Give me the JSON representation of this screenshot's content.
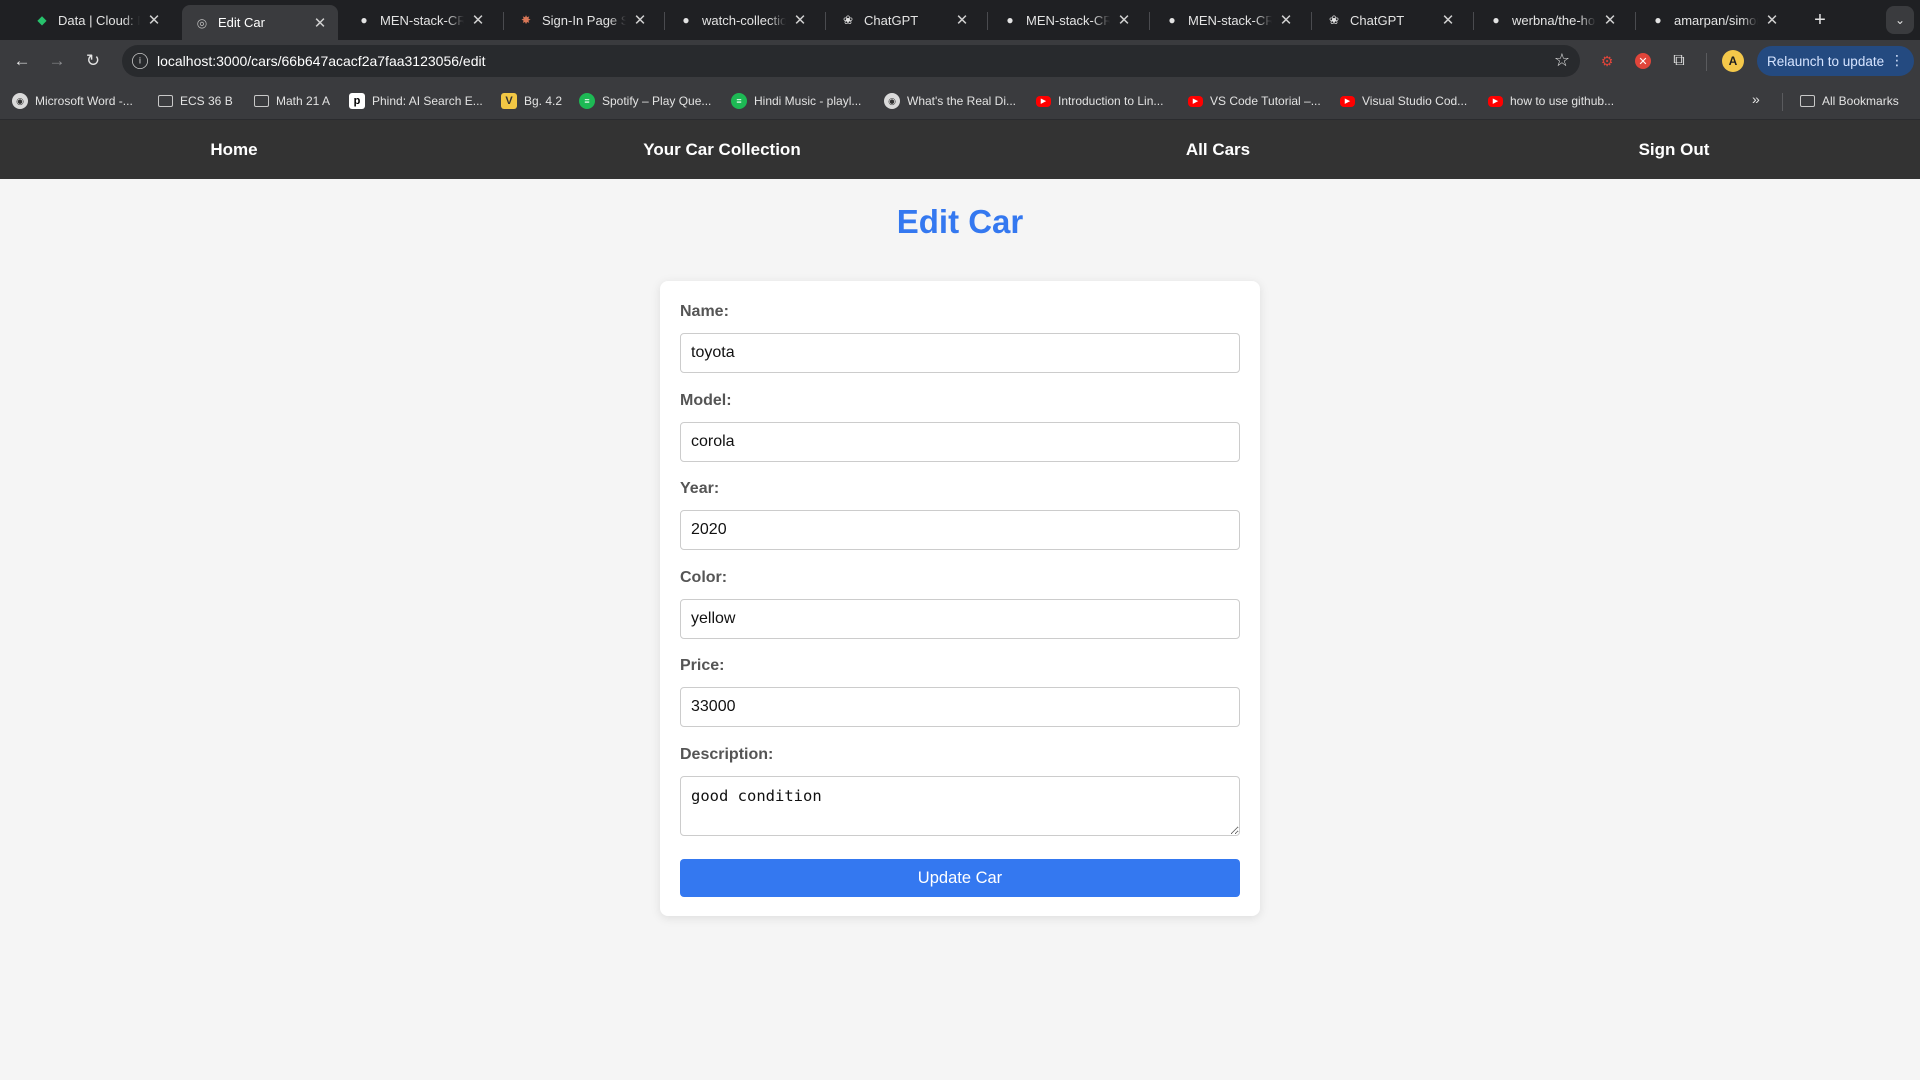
{
  "browser": {
    "tabs": [
      {
        "title": "Data | Cloud: Mo",
        "icon": "mongodb-icon",
        "active": false
      },
      {
        "title": "Edit Car",
        "icon": "globe-icon",
        "active": true
      },
      {
        "title": "MEN-stack-CRU",
        "icon": "github-icon",
        "active": false
      },
      {
        "title": "Sign-In Page St",
        "icon": "claude-icon",
        "active": false
      },
      {
        "title": "watch-collection",
        "icon": "github-icon",
        "active": false
      },
      {
        "title": "ChatGPT",
        "icon": "chatgpt-icon",
        "active": false
      },
      {
        "title": "MEN-stack-CRU",
        "icon": "github-icon",
        "active": false
      },
      {
        "title": "MEN-stack-CRU",
        "icon": "github-icon",
        "active": false
      },
      {
        "title": "ChatGPT",
        "icon": "chatgpt-icon",
        "active": false
      },
      {
        "title": "werbna/the-hom",
        "icon": "github-icon",
        "active": false
      },
      {
        "title": "amarpan/simon",
        "icon": "github-icon",
        "active": false
      }
    ],
    "url": "localhost:3000/cars/66b647acacf2a7faa3123056/edit",
    "relaunch_label": "Relaunch to update",
    "avatar_letter": "A",
    "bookmarks": [
      {
        "label": "Microsoft Word -...",
        "icon": "gray"
      },
      {
        "label": "ECS 36 B",
        "icon": "folder"
      },
      {
        "label": "Math 21 A",
        "icon": "folder"
      },
      {
        "label": "Phind: AI Search E...",
        "icon": "phind"
      },
      {
        "label": "Bg. 4.2",
        "icon": "v"
      },
      {
        "label": "Spotify – Play Que...",
        "icon": "spot"
      },
      {
        "label": "Hindi Music - playl...",
        "icon": "spot"
      },
      {
        "label": "What's the Real Di...",
        "icon": "gray"
      },
      {
        "label": "Introduction to Lin...",
        "icon": "yt"
      },
      {
        "label": "VS Code Tutorial –...",
        "icon": "yt"
      },
      {
        "label": "Visual Studio Cod...",
        "icon": "yt"
      },
      {
        "label": "how to use github...",
        "icon": "yt"
      }
    ],
    "all_bookmarks_label": "All Bookmarks"
  },
  "nav": {
    "home": "Home",
    "collection": "Your Car Collection",
    "all_cars": "All Cars",
    "sign_out": "Sign Out"
  },
  "page": {
    "title": "Edit Car"
  },
  "form": {
    "name_label": "Name:",
    "name_value": "toyota",
    "model_label": "Model:",
    "model_value": "corola",
    "year_label": "Year:",
    "year_value": "2020",
    "color_label": "Color:",
    "color_value": "yellow",
    "price_label": "Price:",
    "price_value": "33000",
    "description_label": "Description:",
    "description_value": "good condition",
    "submit_label": "Update Car"
  },
  "colors": {
    "accent": "#3478f0",
    "navbar": "#333333",
    "page_bg": "#f5f5f5"
  }
}
